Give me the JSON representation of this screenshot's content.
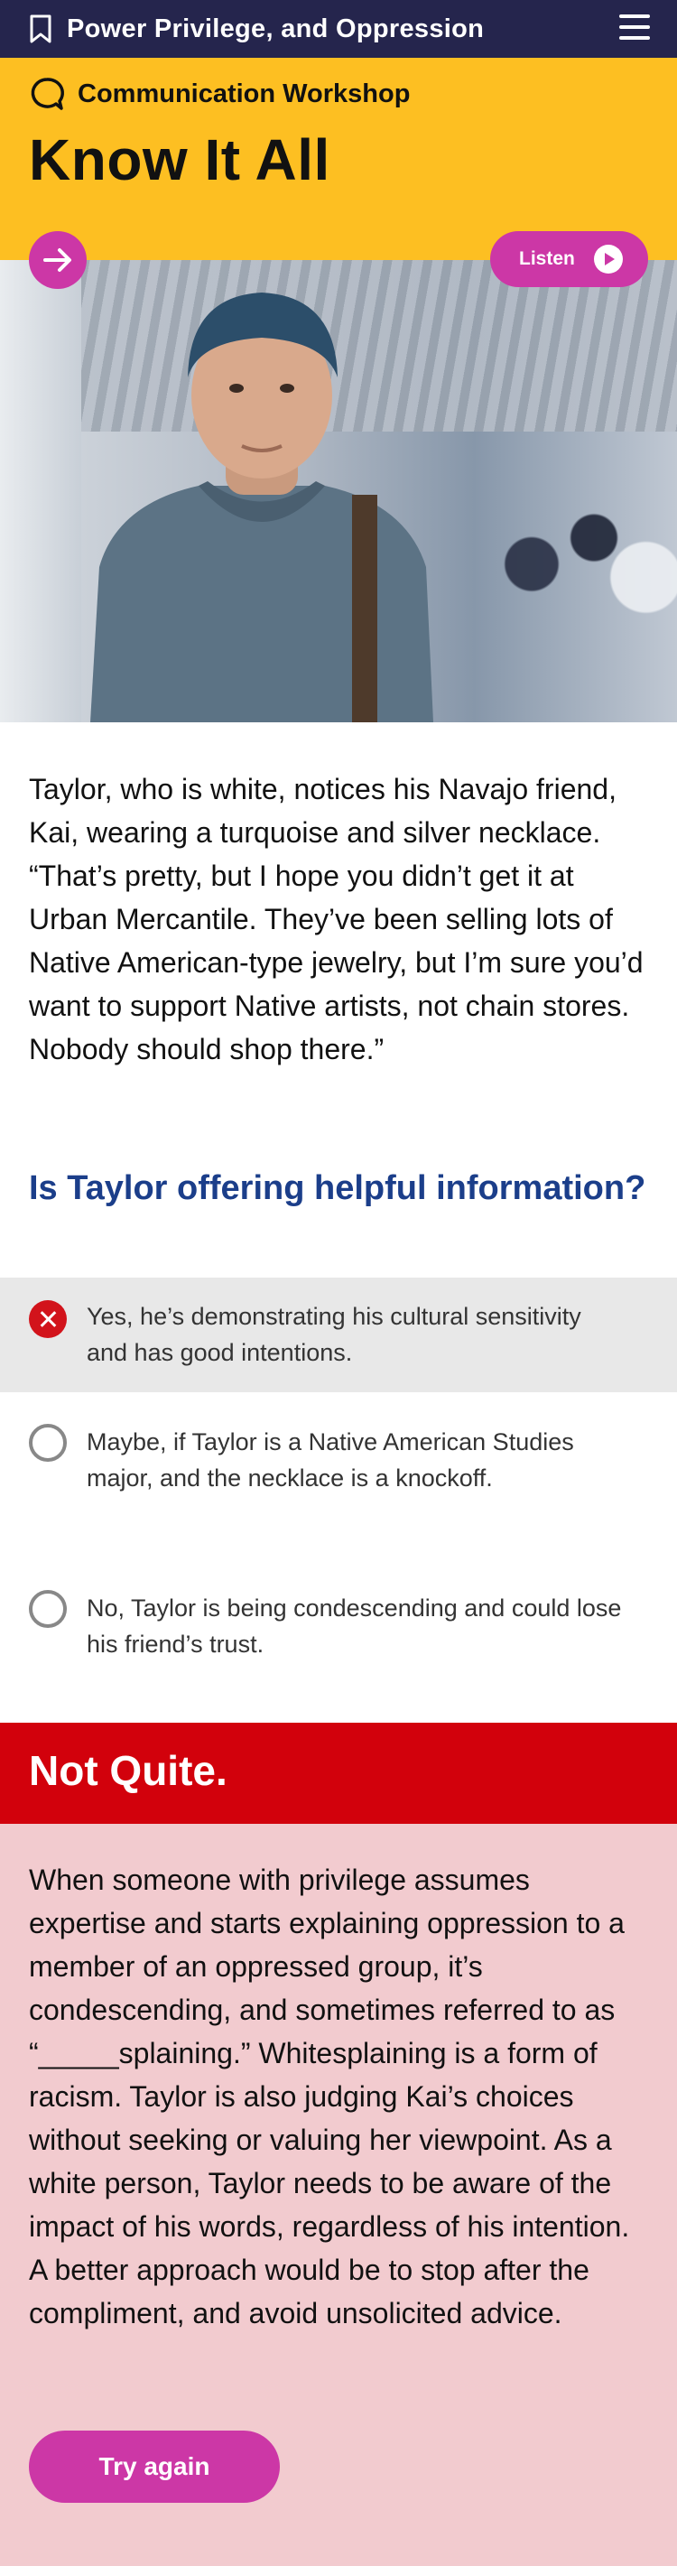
{
  "topbar": {
    "title": "Power Privilege, and Oppression"
  },
  "hero": {
    "workshop_label": "Communication Workshop",
    "title": "Know It All",
    "listen_label": "Listen"
  },
  "scenario": "Taylor, who is white, notices his Navajo friend, Kai, wearing a turquoise and silver necklace. “That’s pretty, but I hope you didn’t get it at Urban Mercantile. They’ve been selling lots of Native American-type jewelry, but I’m sure you’d want to support Native artists, not chain stores. Nobody should shop there.”",
  "question": "Is Taylor offering helpful information?",
  "options": [
    {
      "text": "Yes, he’s demonstrating his cultural sensitivity and has good intentions.",
      "state": "selected-wrong"
    },
    {
      "text": "Maybe, if Taylor is a Native American Studies major, and the necklace is a knockoff.",
      "state": "unselected"
    },
    {
      "text": "No, Taylor is being condescending and could lose his friend’s trust.",
      "state": "unselected"
    }
  ],
  "feedback": {
    "title": "Not Quite.",
    "text": "When someone with privilege assumes expertise and starts explaining oppression to a member of an oppressed group, it’s condescending, and sometimes referred to as “_____splaining.” Whitesplaining is a form of racism. Taylor is also judging Kai’s choices without seeking or valuing her viewpoint. As a white person, Taylor needs to be aware of the impact of his words, regardless of his intention. A better approach would be to stop after the compliment, and avoid unsolicited advice.",
    "button_label": "Try again"
  },
  "colors": {
    "header": "#25254d",
    "hero": "#fdbf22",
    "accent": "#cc37a6",
    "question": "#1b3e8a",
    "error": "#d2010c",
    "feedback_bg": "#f2cbcf"
  }
}
